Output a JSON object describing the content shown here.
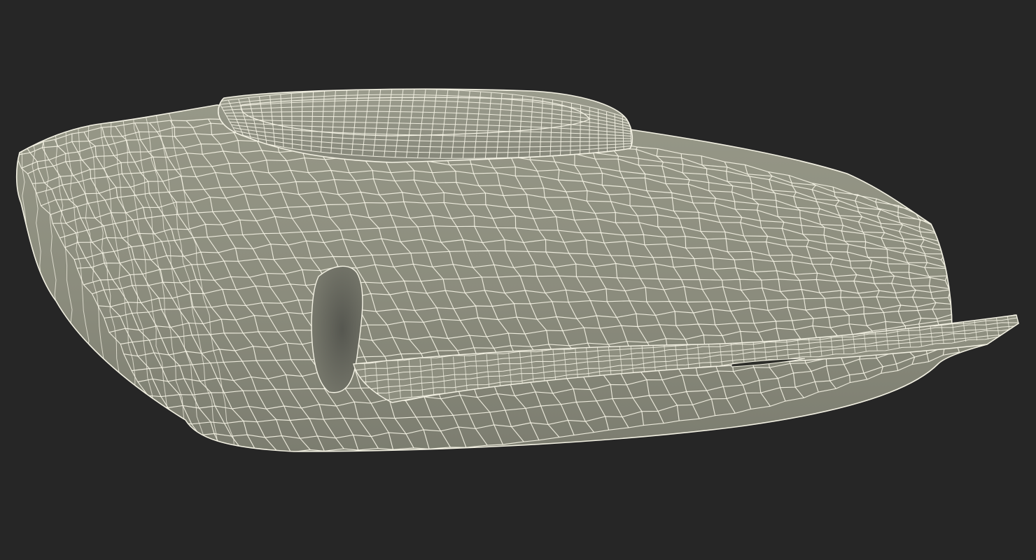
{
  "scene": {
    "subject": "wireframe-3d-model",
    "colors": {
      "background": "#262626",
      "surface": "#8a8b7c",
      "surface_shadow": "#6d6e62",
      "surface_highlight": "#9a9b8c",
      "wire": "#f4f2e4"
    }
  }
}
